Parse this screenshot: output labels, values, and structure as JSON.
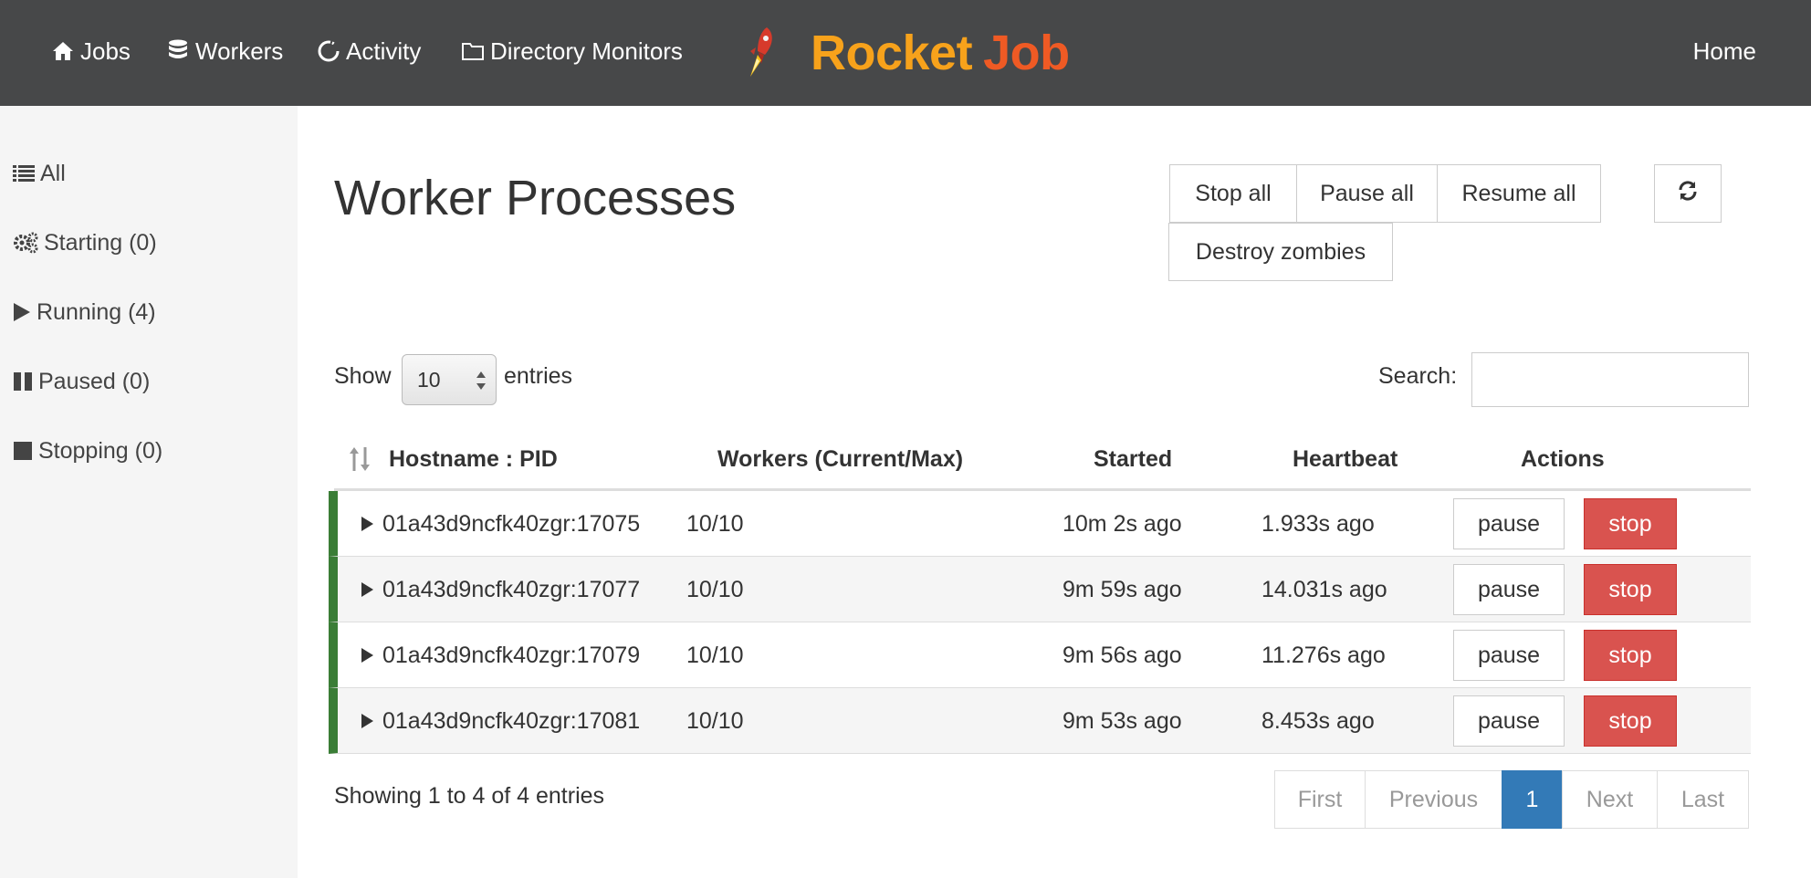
{
  "nav": {
    "items": [
      {
        "label": "Jobs",
        "icon": "home-icon"
      },
      {
        "label": "Workers",
        "icon": "database-icon"
      },
      {
        "label": "Activity",
        "icon": "refresh-circle-icon"
      },
      {
        "label": "Directory Monitors",
        "icon": "folder-icon"
      }
    ],
    "brand_rocket": "Rocket",
    "brand_job": "Job",
    "home": "Home"
  },
  "sidebar": {
    "items": [
      {
        "label": "All",
        "icon": "list-icon"
      },
      {
        "label": "Starting (0)",
        "icon": "gears-icon"
      },
      {
        "label": "Running (4)",
        "icon": "play-icon"
      },
      {
        "label": "Paused (0)",
        "icon": "pause-icon"
      },
      {
        "label": "Stopping (0)",
        "icon": "stop-icon"
      }
    ]
  },
  "main": {
    "title": "Worker Processes",
    "buttons": {
      "stop_all": "Stop all",
      "pause_all": "Pause all",
      "resume_all": "Resume all",
      "destroy_zombies": "Destroy zombies",
      "refresh_icon": "refresh-icon"
    },
    "length": {
      "show": "Show",
      "value": "10",
      "entries": "entries"
    },
    "search": {
      "label": "Search:",
      "value": ""
    }
  },
  "table": {
    "headers": [
      "Hostname : PID",
      "Workers (Current/Max)",
      "Started",
      "Heartbeat",
      "Actions"
    ],
    "rows": [
      {
        "host": "01a43d9ncfk40zgr:17075",
        "workers": "10/10",
        "started": "10m 2s ago",
        "heartbeat": "1.933s ago"
      },
      {
        "host": "01a43d9ncfk40zgr:17077",
        "workers": "10/10",
        "started": "9m 59s ago",
        "heartbeat": "14.031s ago"
      },
      {
        "host": "01a43d9ncfk40zgr:17079",
        "workers": "10/10",
        "started": "9m 56s ago",
        "heartbeat": "11.276s ago"
      },
      {
        "host": "01a43d9ncfk40zgr:17081",
        "workers": "10/10",
        "started": "9m 53s ago",
        "heartbeat": "8.453s ago"
      }
    ],
    "row_actions": {
      "pause": "pause",
      "stop": "stop"
    }
  },
  "footer": {
    "info": "Showing 1 to 4 of 4 entries",
    "pager": {
      "first": "First",
      "previous": "Previous",
      "current": "1",
      "next": "Next",
      "last": "Last"
    }
  },
  "colors": {
    "navbar": "#474849",
    "brand_rocket": "#f7a21b",
    "brand_job": "#ef5a24",
    "danger": "#d9534f",
    "primary": "#337ab7",
    "running": "#3a7d36"
  }
}
